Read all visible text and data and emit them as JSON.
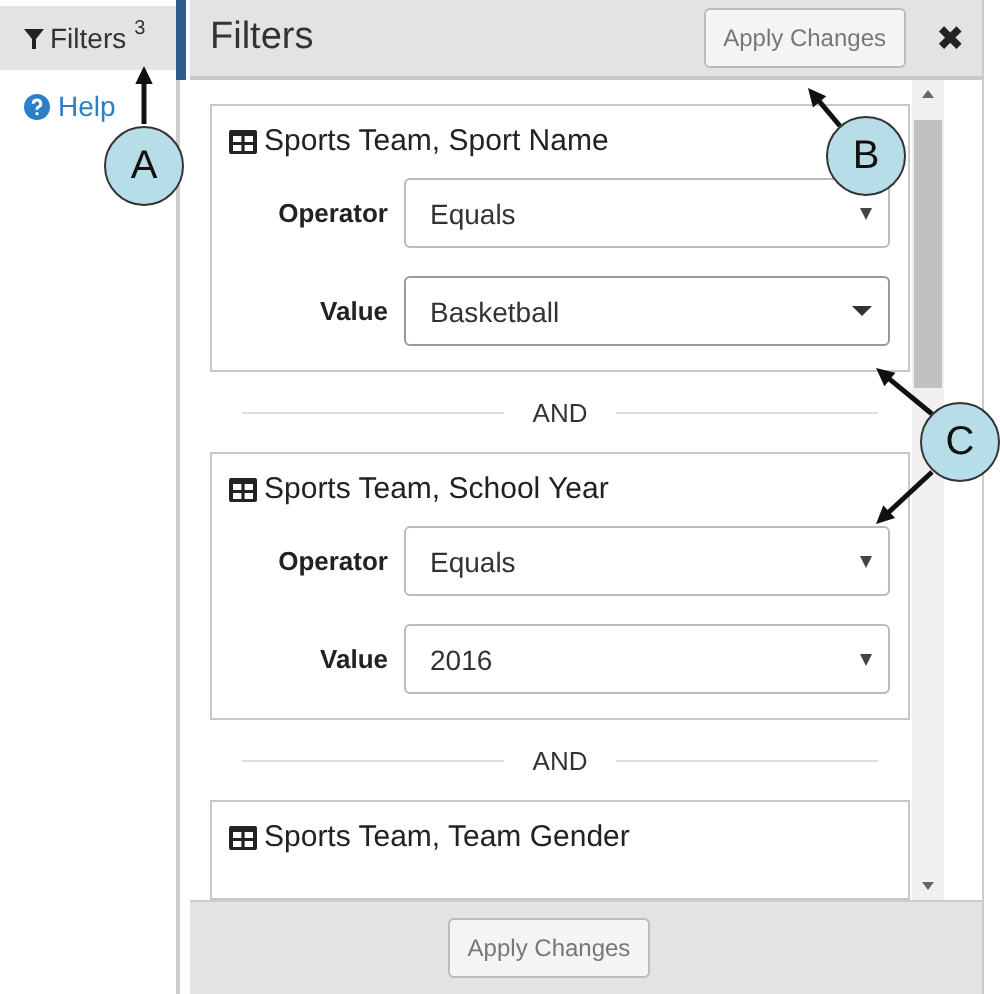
{
  "sidebar": {
    "tab": {
      "label": "Filters",
      "count": "3",
      "selected": true
    },
    "help": "Help"
  },
  "panel": {
    "title": "Filters",
    "apply_top": "Apply Changes",
    "close": "✖",
    "apply_bottom": "Apply Changes",
    "filters": [
      {
        "title": "Sports Team, Sport Name",
        "fields": [
          {
            "label": "Operator",
            "value": "Equals",
            "kind": "native"
          },
          {
            "label": "Value",
            "value": "Basketball",
            "kind": "custom"
          }
        ]
      },
      {
        "join": "AND",
        "title": "Sports Team, School Year",
        "fields": [
          {
            "label": "Operator",
            "value": "Equals",
            "kind": "native"
          },
          {
            "label": "Value",
            "value": "2016",
            "kind": "native"
          }
        ]
      },
      {
        "join": "AND",
        "title": "Sports Team, Team Gender"
      }
    ]
  },
  "callouts": [
    {
      "label": "A"
    },
    {
      "label": "B"
    },
    {
      "label": "C"
    }
  ]
}
